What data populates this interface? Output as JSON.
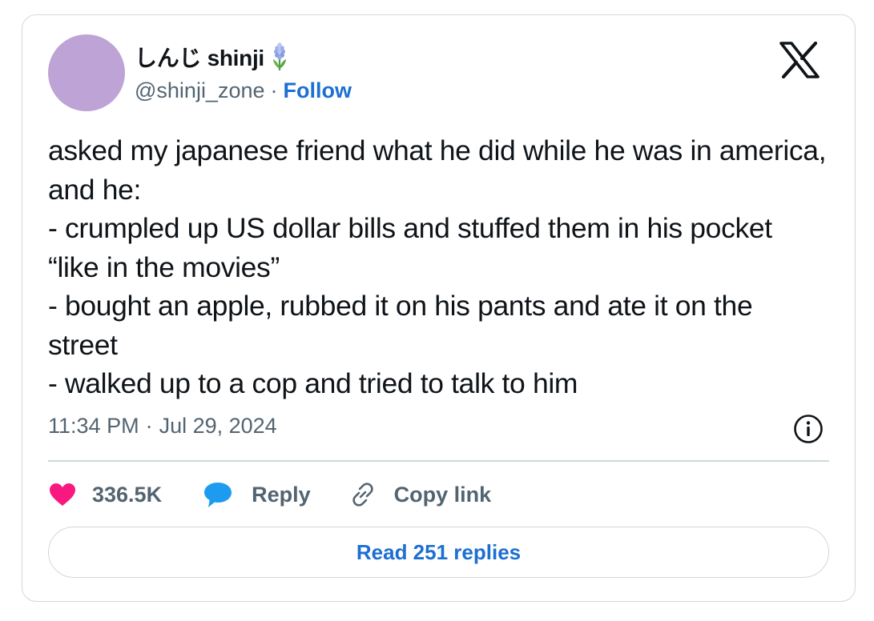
{
  "author": {
    "display_name": "しんじ shinji",
    "handle": "@shinji_zone",
    "separator": "·",
    "follow_label": "Follow",
    "avatar_color": "#bea4d6",
    "name_emoji_icon": "hyacinth-icon"
  },
  "brand": {
    "logo_icon": "x-logo-icon"
  },
  "tweet": {
    "lines": [
      "asked my japanese friend what he did while he was in america, and he:",
      "- crumpled up US dollar bills and stuffed them in his pocket “like in the movies”",
      "- bought an apple, rubbed it on his pants and ate it on the street",
      "- walked up to a cop and tried to talk to him"
    ],
    "time": "11:34 PM",
    "separator": "·",
    "date": "Jul 29, 2024"
  },
  "actions": {
    "like_count": "336.5K",
    "reply_label": "Reply",
    "copy_link_label": "Copy link",
    "like_color": "#f91880",
    "reply_color": "#1d9bf0"
  },
  "footer": {
    "read_replies_label": "Read 251 replies"
  },
  "colors": {
    "link_blue": "#1d6fd1",
    "secondary_text": "#536471",
    "border": "#cfd9de"
  }
}
